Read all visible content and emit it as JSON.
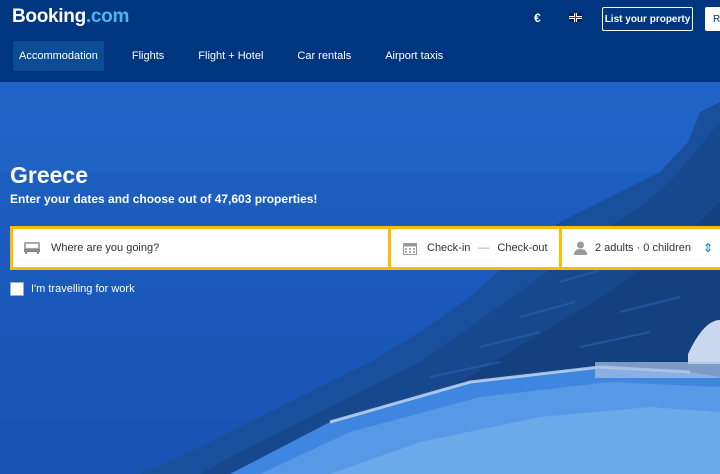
{
  "header": {
    "logo_main": "Booking",
    "logo_tld": ".com",
    "currency": "€",
    "list_property": "List your property",
    "register": "Re"
  },
  "nav": {
    "items": [
      {
        "label": "Accommodation",
        "active": true
      },
      {
        "label": "Flights"
      },
      {
        "label": "Flight + Hotel"
      },
      {
        "label": "Car rentals"
      },
      {
        "label": "Airport taxis"
      }
    ]
  },
  "hero": {
    "title": "Greece",
    "subtitle": "Enter your dates and choose out of 47,603 properties!"
  },
  "search": {
    "destination_placeholder": "Where are you going?",
    "checkin": "Check-in",
    "dash": "—",
    "checkout": "Check-out",
    "guests": "2 adults · 0 children",
    "work_travel": "I'm travelling for work"
  },
  "colors": {
    "brand_blue": "#003580",
    "accent_yellow": "#febb02",
    "link_blue": "#0071c2"
  },
  "icons": [
    "bed-icon",
    "calendar-icon",
    "person-icon",
    "chevron-updown-icon",
    "uk-flag-icon"
  ]
}
